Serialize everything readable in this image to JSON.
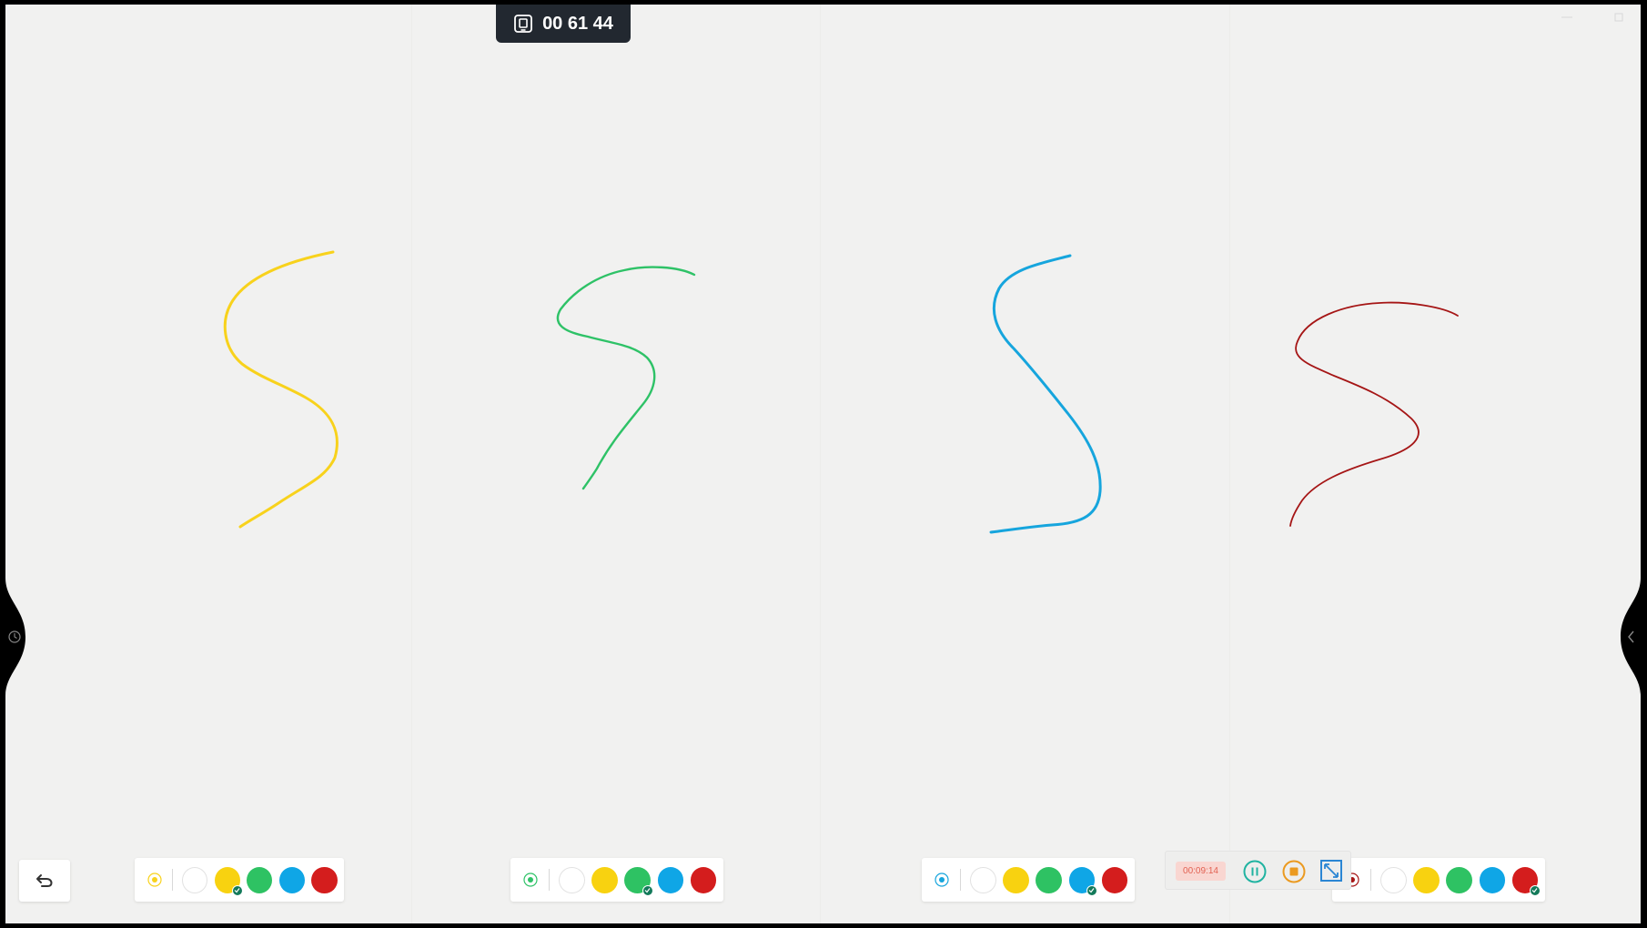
{
  "top_timer": {
    "icon": "screen-record-icon",
    "value": "00 61 44"
  },
  "strokes": [
    {
      "name": "yellow-s-stroke",
      "color": "#f8d21c"
    },
    {
      "name": "green-s-stroke",
      "color": "#2ec267"
    },
    {
      "name": "blue-s-stroke",
      "color": "#16a5dd"
    },
    {
      "name": "red-s-stroke",
      "color": "#a51515"
    }
  ],
  "palette_colors": {
    "white": "#ffffff",
    "yellow": "#f8d210",
    "green": "#2ec263",
    "blue": "#0fa6e6",
    "red": "#d41d1d"
  },
  "palettes": [
    {
      "pen_color": "#f8d21c",
      "selected": "yellow"
    },
    {
      "pen_color": "#2ec267",
      "selected": "green"
    },
    {
      "pen_color": "#16a5dd",
      "selected": "blue"
    },
    {
      "pen_color": "#a51515",
      "selected": "red"
    }
  ],
  "recorder": {
    "time": "00:09:14",
    "pause_icon": "pause-icon",
    "stop_icon": "stop-icon",
    "expand_icon": "expand-icon"
  },
  "undo": {
    "icon": "undo-icon"
  },
  "side_handles": {
    "left_icon": "clock-icon",
    "right_icon": "chevron-left-icon"
  }
}
